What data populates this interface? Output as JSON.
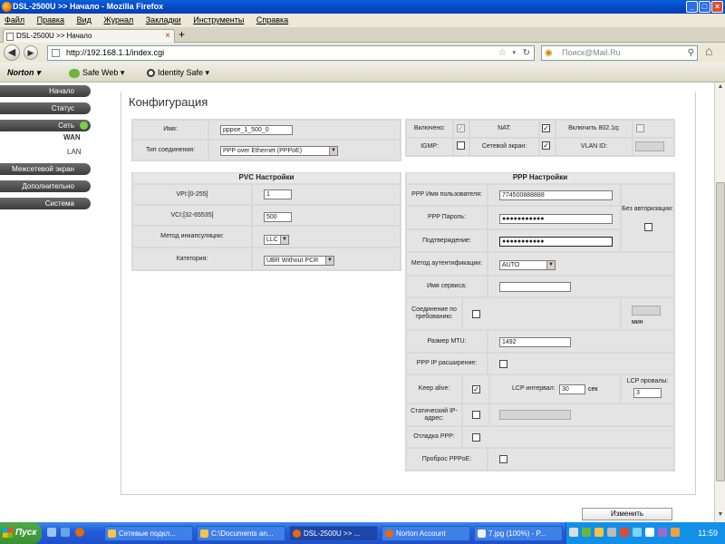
{
  "window": {
    "title": "DSL-2500U >> Начало - Mozilla Firefox"
  },
  "menu": [
    "Файл",
    "Правка",
    "Вид",
    "Журнал",
    "Закладки",
    "Инструменты",
    "Справка"
  ],
  "tab": {
    "label": "DSL-2500U >> Начало",
    "new_tab": "+"
  },
  "address": {
    "url": "http://192.168.1.1/index.cgi"
  },
  "search": {
    "placeholder": "Поиск@Mail.Ru"
  },
  "norton": {
    "logo": "Norton",
    "safe_web": "Safe Web",
    "identity_safe": "Identity Safe"
  },
  "sidebar": {
    "items": [
      "Начало",
      "Статус",
      "Сеть",
      "Межсетевой экран",
      "Дополнительно",
      "Система"
    ],
    "sub": [
      "WAN",
      "LAN"
    ]
  },
  "page": {
    "title": "Конфигурация"
  },
  "top": {
    "name_label": "Имя:",
    "name_value": "pppoe_1_500_0",
    "conn_label": "Тип соединения:",
    "conn_value": "PPP over Ethernet (PPPoE)",
    "enabled_label": "Включено:",
    "nat_label": "NAT:",
    "vlan8021q_label": "Включить 802.1q:",
    "igmp_label": "IGMP:",
    "firewall_label": "Сетевой экран:",
    "vlanid_label": "VLAN ID:"
  },
  "pvc": {
    "header": "PVC Настройки",
    "vpi_label": "VPI:[0-255]",
    "vpi_value": "1",
    "vci_label": "VCI:[32-65535]",
    "vci_value": "500",
    "encap_label": "Метод инкапсуляции:",
    "encap_value": "LLC",
    "category_label": "Категория:",
    "category_value": "UBR Without PCR"
  },
  "ppp": {
    "header": "PPP Настройки",
    "user_label": "PPP Имя пользователя:",
    "user_value": "774500888888",
    "pass_label": "PPP Пароль:",
    "pass_value": "●●●●●●●●●●●",
    "confirm_label": "Подтверждение:",
    "confirm_value": "●●●●●●●●●●●",
    "noauth_label": "Без авторизации:",
    "auth_label": "Метод аутентификации:",
    "auth_value": "AUTO",
    "service_label": "Имя сервиса:",
    "service_value": "",
    "ondemand_label": "Соединение по требованию:",
    "minutes_label": "мин",
    "mtu_label": "Размер MTU:",
    "mtu_value": "1492",
    "ipext_label": "PPP IP расширение:",
    "keepalive_label": "Keep alive:",
    "lcp_interval_label": "LCP интервал:",
    "lcp_interval_value": "30",
    "lcp_interval_unit": "сек",
    "lcp_fail_label": "LCP провалы:",
    "lcp_fail_value": "3",
    "static_ip_label": "Статический IP-адрес:",
    "debug_label": "Отладка PPP:",
    "passthrough_label": "Проброс PPPoE:"
  },
  "buttons": {
    "change": "Изменить"
  },
  "taskbar": {
    "start": "Пуск",
    "items": [
      "Сетевые подкл...",
      "C:\\Documents an...",
      "DSL-2500U >> ...",
      "Norton Account",
      "7.jpg (100%) - P..."
    ],
    "clock": "11:59"
  }
}
